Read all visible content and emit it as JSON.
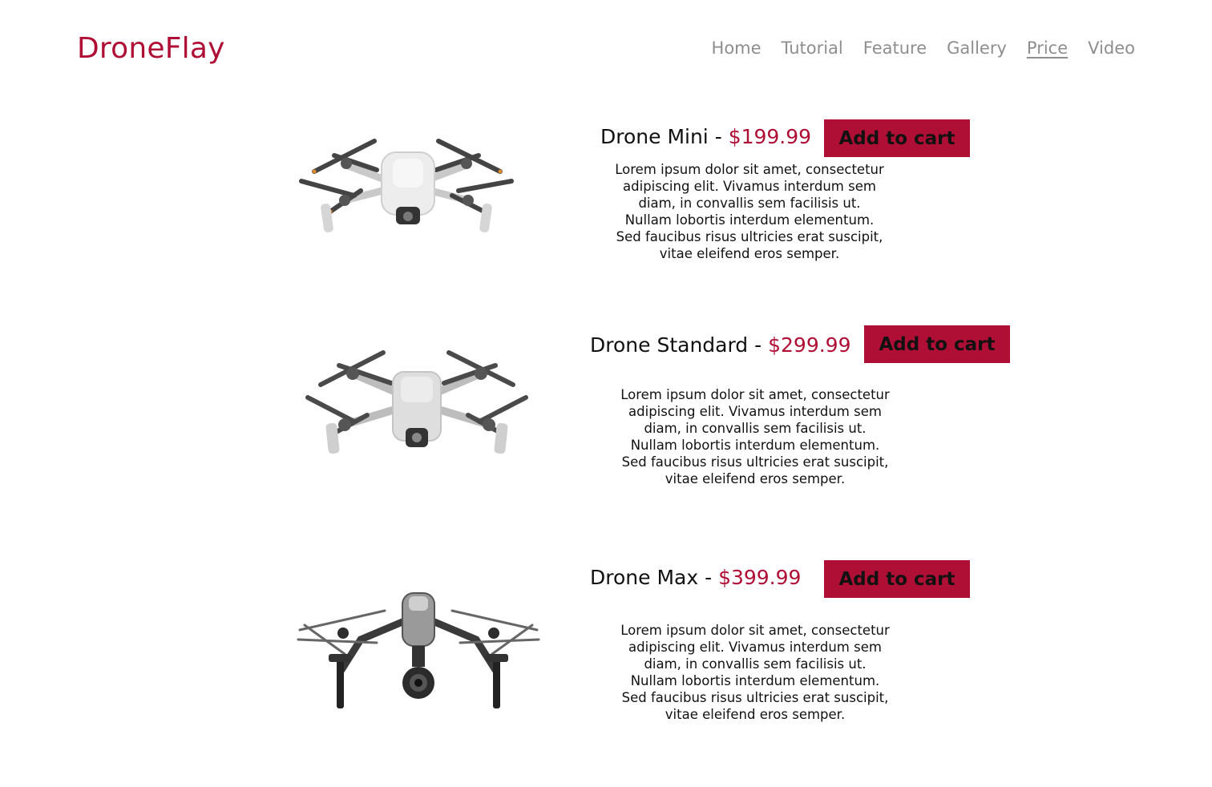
{
  "brand": {
    "name": "DroneFlay",
    "accent": "#b00f35"
  },
  "nav": {
    "items": [
      "Home",
      "Tutorial",
      "Feature",
      "Gallery",
      "Price",
      "Video"
    ],
    "active": "Price"
  },
  "products": [
    {
      "name": "Drone Mini",
      "separator": " - ",
      "price": "$199.99",
      "button": "Add to cart",
      "image": "drone-mini-icon",
      "description": "Lorem ipsum dolor sit amet, consectetur adipiscing elit. Vivamus interdum sem diam, in convallis sem facilisis ut. Nullam lobortis interdum elementum. Sed faucibus risus ultricies erat suscipit, vitae eleifend eros semper."
    },
    {
      "name": "Drone Standard",
      "separator": " - ",
      "price": "$299.99",
      "button": "Add to cart",
      "image": "drone-standard-icon",
      "description": "Lorem ipsum dolor sit amet, consectetur adipiscing elit. Vivamus interdum sem diam, in convallis sem facilisis ut. Nullam lobortis interdum elementum. Sed faucibus risus ultricies erat suscipit, vitae eleifend eros semper."
    },
    {
      "name": "Drone Max",
      "separator": " - ",
      "price": "$399.99",
      "button": "Add to cart",
      "image": "drone-max-icon",
      "description": "Lorem ipsum dolor sit amet, consectetur adipiscing elit. Vivamus interdum sem diam, in convallis sem facilisis ut. Nullam lobortis interdum elementum. Sed faucibus risus ultricies erat suscipit, vitae eleifend eros semper."
    }
  ]
}
